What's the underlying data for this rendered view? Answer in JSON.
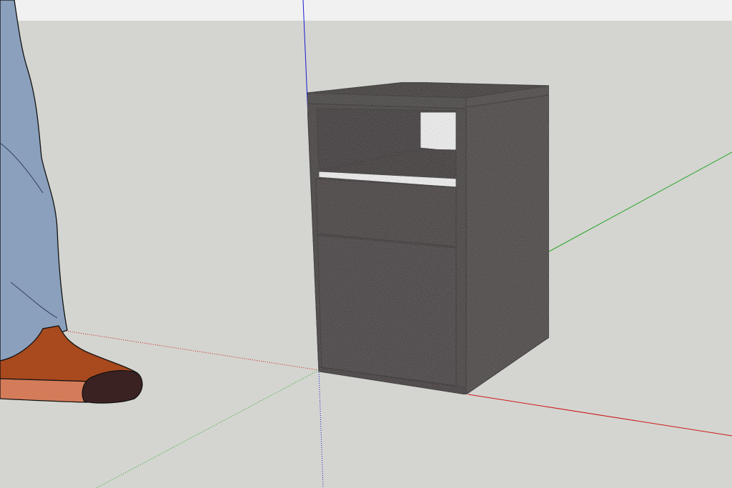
{
  "app": {
    "kind": "3d-modeling-viewport"
  },
  "scene": {
    "model": "cabinet-with-open-shelf-and-two-drawers",
    "scale_figure": "person-legs-with-shoes"
  },
  "axes": {
    "red_axis_color": "#cc1a1a",
    "green_axis_color": "#2aa52a",
    "blue_axis_color": "#1a1ad0"
  },
  "colors": {
    "sky": "#f1f1f1",
    "ground": "#d4d5d0",
    "cabinet_dark": "#3a3536",
    "cabinet_top": "#2f2c2d",
    "cabinet_side": "#413c3d",
    "shelf_white": "#ffffff",
    "jeans": "#8aa0bc",
    "shoe_orange": "#a8491e",
    "shoe_sole": "#d47c5a",
    "shoe_toe": "#3b2222"
  }
}
